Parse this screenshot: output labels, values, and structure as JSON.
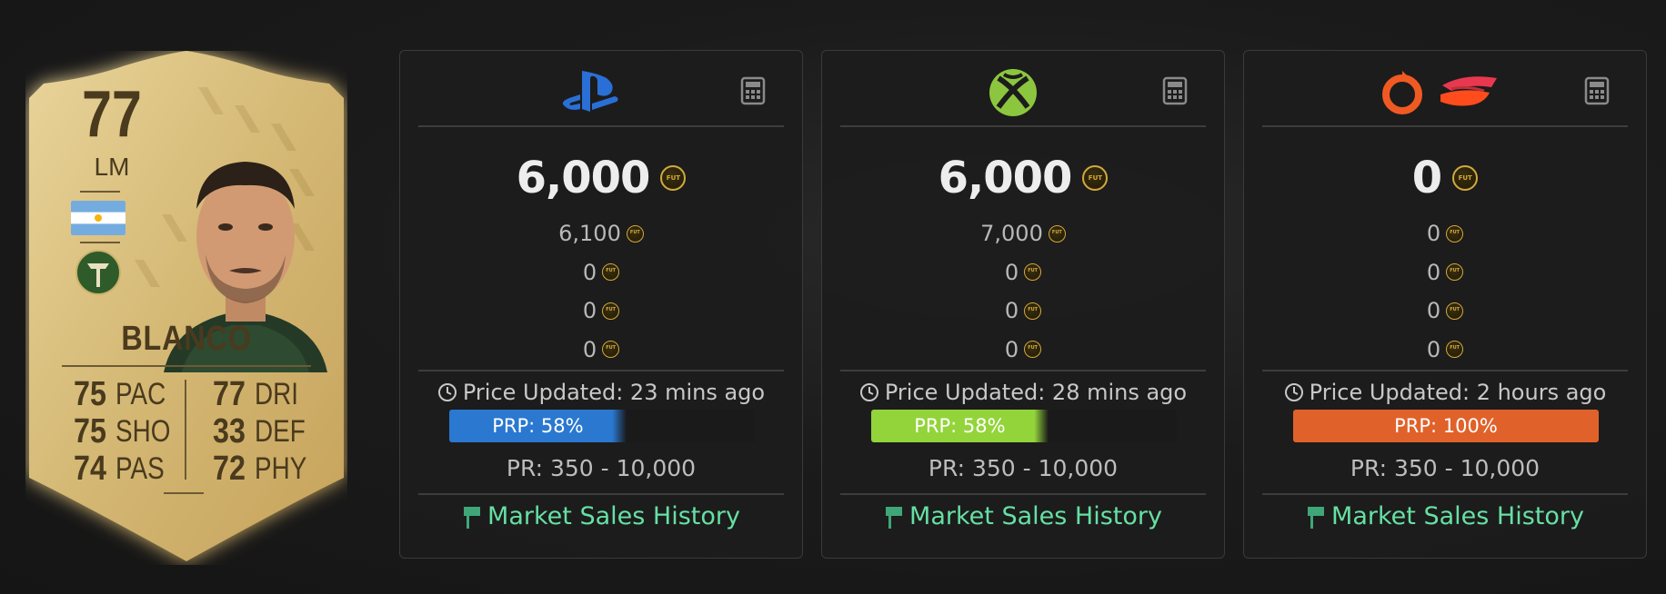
{
  "player": {
    "rating": "77",
    "position": "LM",
    "name": "BLANCO",
    "nation_flag": "argentina-flag",
    "club_badge": "portland-timbers-badge",
    "stats_left": [
      {
        "value": "75",
        "label": "PAC"
      },
      {
        "value": "75",
        "label": "SHO"
      },
      {
        "value": "74",
        "label": "PAS"
      }
    ],
    "stats_right": [
      {
        "value": "77",
        "label": "DRI"
      },
      {
        "value": "33",
        "label": "DEF"
      },
      {
        "value": "72",
        "label": "PHY"
      }
    ]
  },
  "panels": [
    {
      "platform": "playstation",
      "logo_icon": "playstation-logo-icon",
      "price": "6,000",
      "other_prices": [
        "6,100",
        "0",
        "0",
        "0"
      ],
      "updated": "Price Updated: 23 mins ago",
      "prp_label": "PRP: 58%",
      "prp_fraction": 0.58,
      "prp_color": "#2a78d0",
      "pr_range": "PR: 350 - 10,000",
      "history_label": "Market Sales History"
    },
    {
      "platform": "xbox",
      "logo_icon": "xbox-logo-icon",
      "price": "6,000",
      "other_prices": [
        "7,000",
        "0",
        "0",
        "0"
      ],
      "updated": "Price Updated: 28 mins ago",
      "prp_label": "PRP: 58%",
      "prp_fraction": 0.58,
      "prp_color": "#93d43a",
      "pr_range": "PR: 350 - 10,000",
      "history_label": "Market Sales History"
    },
    {
      "platform": "pc",
      "logo_icon": "origin-stadia-logo-icon",
      "price": "0",
      "other_prices": [
        "0",
        "0",
        "0",
        "0"
      ],
      "updated": "Price Updated: 2 hours ago",
      "prp_label": "PRP: 100%",
      "prp_fraction": 1.0,
      "prp_color": "#e0622a",
      "pr_range": "PR: 350 - 10,000",
      "history_label": "Market Sales History"
    }
  ],
  "coin_text": "FUT",
  "colors": {
    "history_link": "#66e0a3",
    "coin_gold": "#d2a93e",
    "card_gold": "#d9bf7e"
  }
}
